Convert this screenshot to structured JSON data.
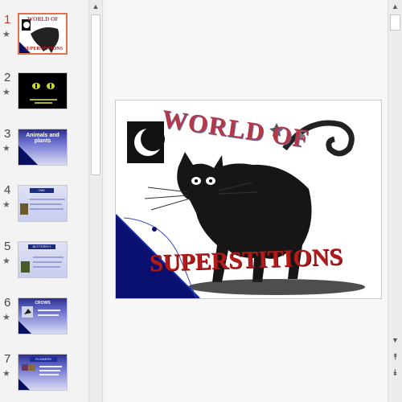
{
  "slides": [
    {
      "number": "1",
      "title": "WORLD OF SUPERSTITIONS",
      "active": true
    },
    {
      "number": "2",
      "title": "",
      "active": false
    },
    {
      "number": "3",
      "title": "Animals and plants",
      "active": false
    },
    {
      "number": "4",
      "title": "OWL",
      "active": false
    },
    {
      "number": "5",
      "title": "BUTTERFLY",
      "active": false
    },
    {
      "number": "6",
      "title": "CROWS",
      "active": false
    },
    {
      "number": "7",
      "title": "FLOWERS",
      "active": false
    }
  ],
  "main_slide": {
    "title_top": "WORLD OF",
    "title_bottom": "SUPERSTITIONS"
  },
  "icons": {
    "star": "★",
    "scroll_up": "▲",
    "scroll_down": "▼",
    "prev_slide": "⯭",
    "next_slide": "⯯"
  },
  "colors": {
    "active_border": "#e0714a",
    "active_number": "#c0392b",
    "title_top": "#b23a48",
    "title_bottom": "#b31b1b"
  }
}
